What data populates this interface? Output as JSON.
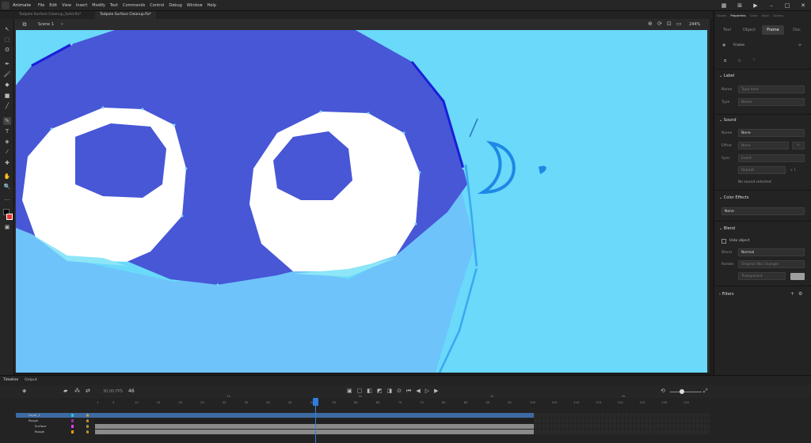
{
  "app": {
    "name": "Animate"
  },
  "menus": [
    "File",
    "Edit",
    "View",
    "Insert",
    "Modify",
    "Text",
    "Commands",
    "Control",
    "Debug",
    "Window",
    "Help"
  ],
  "doc_tabs": [
    {
      "label": "Tadpole Surface Cleanup_Solid.fla*",
      "active": false
    },
    {
      "label": "Tadpole Surface Cleanup.fla*",
      "active": true
    }
  ],
  "stage": {
    "scene": "Scene 1",
    "zoom": "244%"
  },
  "panel": {
    "tabs": [
      "Assets",
      "Properties",
      "Color",
      "Align",
      "Library"
    ],
    "active_tab": "Properties",
    "subtabs": [
      "Tool",
      "Object",
      "Frame",
      "Doc"
    ],
    "active_subtab": "Frame",
    "frame_title": "Frame",
    "label": {
      "header": "Label",
      "name_label": "Name",
      "name_placeholder": "Type here",
      "type_label": "Type",
      "type_value": "Name"
    },
    "sound": {
      "header": "Sound",
      "name_label": "Name",
      "name_value": "None",
      "effect_label": "Effect",
      "effect_value": "None",
      "sync_label": "Sync",
      "sync_value": "Event",
      "repeat_value": "Repeat",
      "repeat_count": "x 1",
      "no_sound": "No sound selected"
    },
    "color_effects": {
      "header": "Color Effects",
      "value": "None"
    },
    "blend": {
      "header": "Blend",
      "hide_object": "Hide object",
      "blend_label": "Blend",
      "blend_value": "Normal",
      "render_label": "Render",
      "render_value": "Original (No Change)",
      "transparent_value": "Transparent"
    },
    "filters": {
      "header": "Filters"
    }
  },
  "timeline": {
    "tabs": [
      "Timeline",
      "Output"
    ],
    "fps": "30.00 FPS",
    "current_frame": "46",
    "ruler": [
      "1",
      "5",
      "10",
      "15",
      "20",
      "25",
      "30",
      "35",
      "40",
      "45",
      "50",
      "55",
      "60",
      "65",
      "70",
      "75",
      "80",
      "85",
      "90",
      "95",
      "100",
      "105",
      "110",
      "115",
      "120",
      "125",
      "130",
      "135"
    ],
    "second_marks": [
      "1s",
      "2s",
      "3s",
      "4s"
    ],
    "layers": [
      {
        "name": "Layer_1",
        "color": "#26c6da",
        "selected": true,
        "depth": 0
      },
      {
        "name": "Rough",
        "color": "#9c27b0",
        "selected": false,
        "depth": 0
      },
      {
        "name": "Surface",
        "color": "#e040fb",
        "selected": false,
        "depth": 1
      },
      {
        "name": "Rough",
        "color": "#ff9800",
        "selected": false,
        "depth": 1
      }
    ]
  },
  "colors": {
    "accent": "#2f7de0",
    "stage_bg": "#6ad9fa",
    "body": "#4757d6",
    "belly": "#6ec3fb",
    "eye_white": "#ffffff"
  }
}
